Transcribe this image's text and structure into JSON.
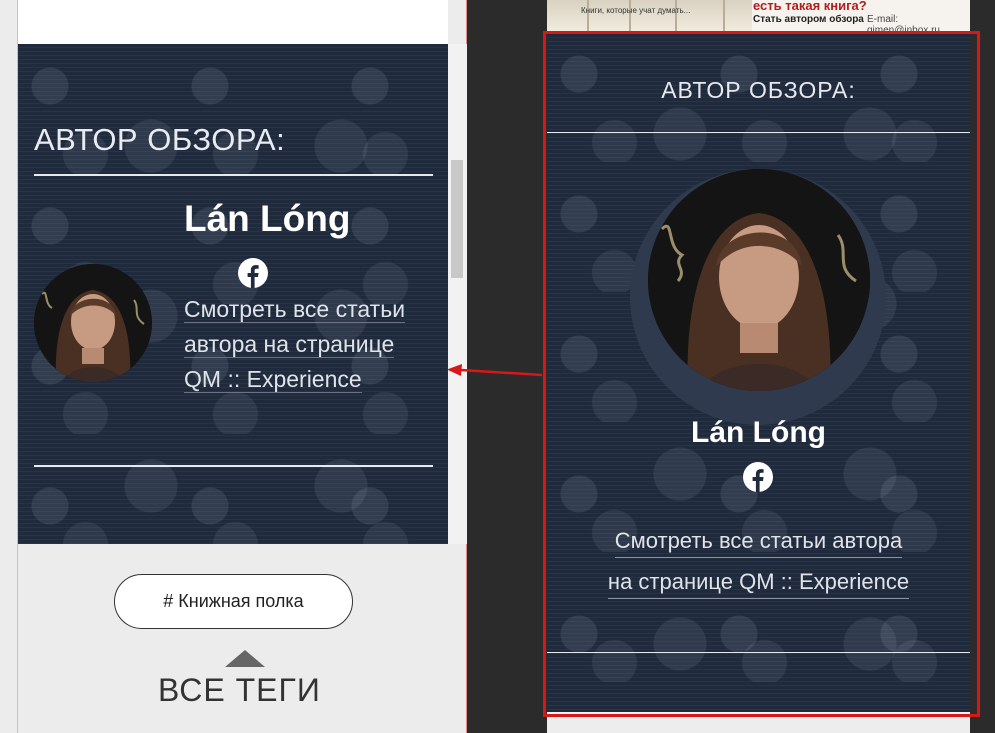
{
  "left_panel": {
    "heading": "АВТОР ОБЗОРА:",
    "author_name": "Lán Lóng",
    "author_link": "Смотреть все статьи автора на странице QM :: Experience",
    "tag_button": "# Книжная полка",
    "all_tags": "ВСЕ ТЕГИ"
  },
  "right_panel": {
    "banner": {
      "tiny_text": "Книги, которые учат думать...",
      "question": "есть такая книга?",
      "become_author": "Стать автором обзора",
      "email": "E-mail: qimen@inbox.ru"
    },
    "heading": "АВТОР ОБЗОРА:",
    "author_name": "Lán Lóng",
    "author_link_line1": "Смотреть все статьи автора",
    "author_link_line2": "на странице QM :: Experience"
  },
  "colors": {
    "card_bg": "#1f2a3c",
    "highlight": "#d61818",
    "text_light": "#e6e9ee"
  },
  "icons": [
    "facebook-icon",
    "author-photo",
    "arrow-left-icon",
    "scroll-up-triangle-icon"
  ]
}
